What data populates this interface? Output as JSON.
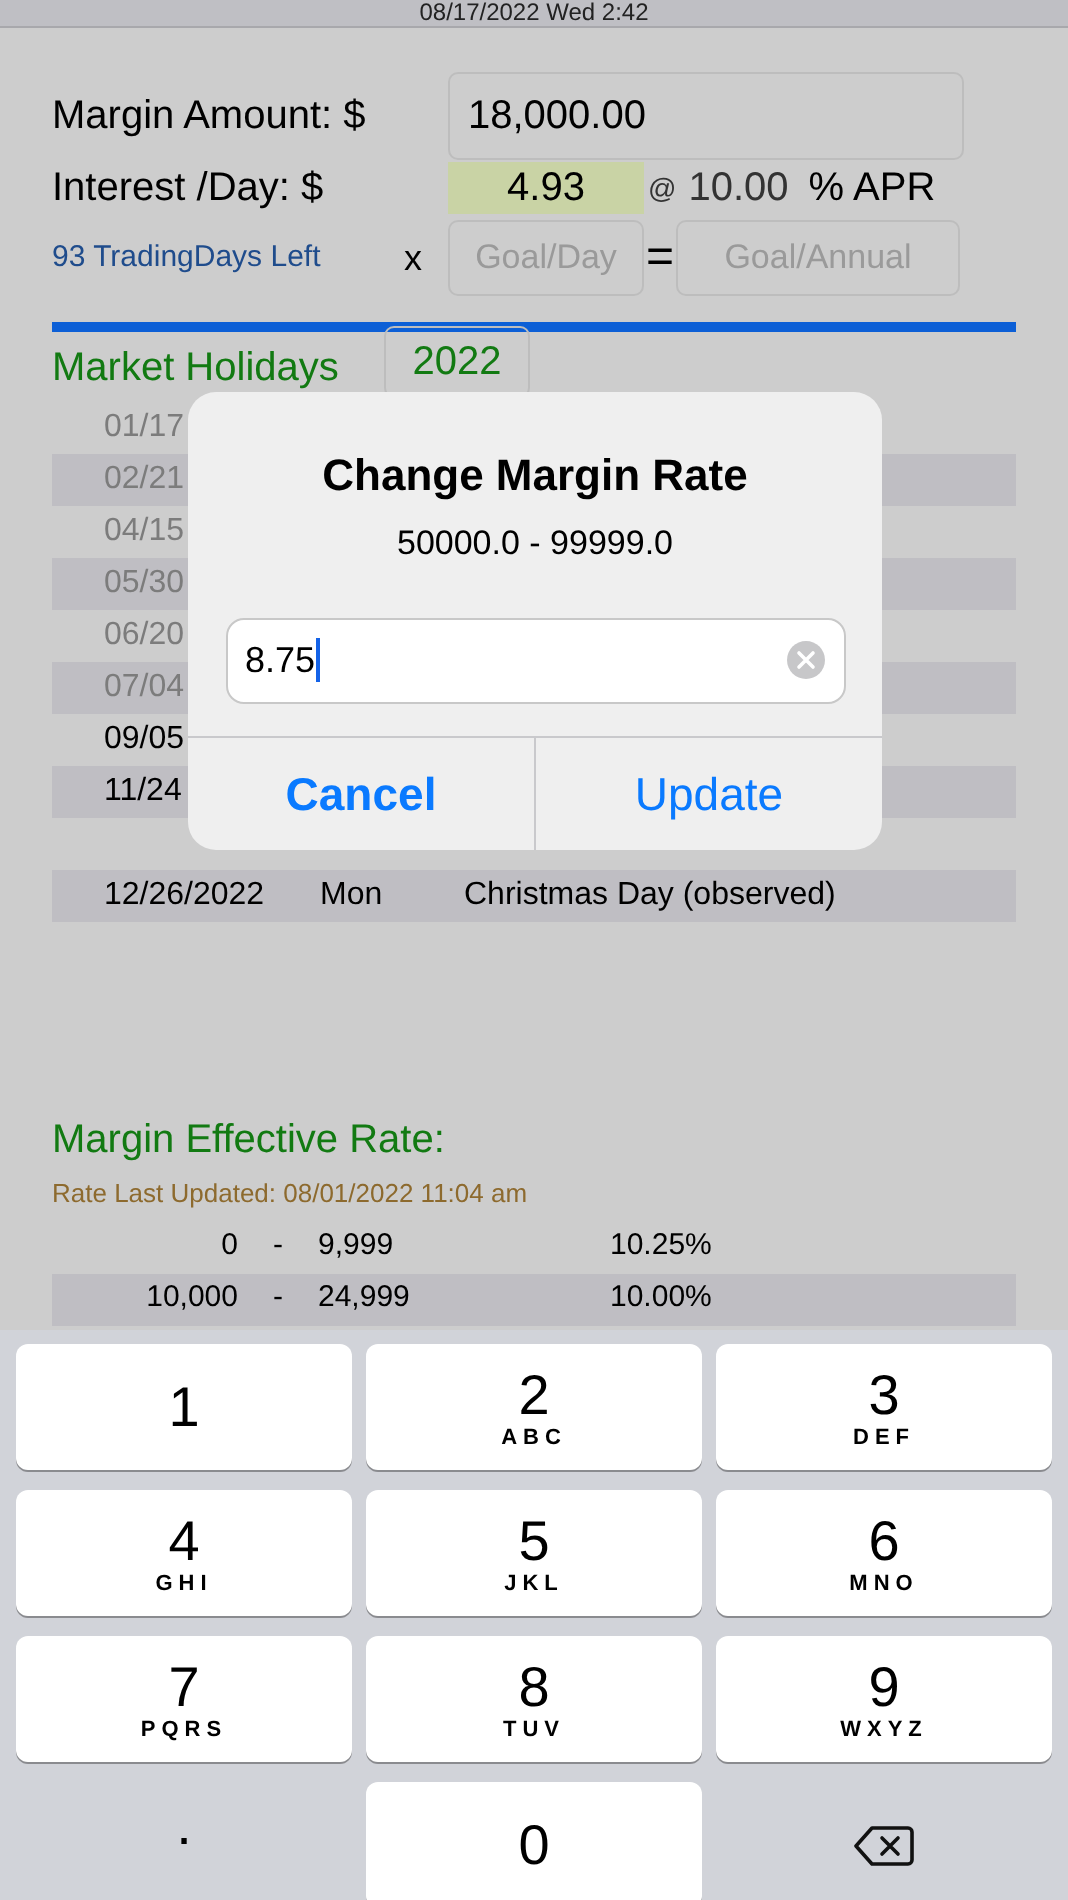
{
  "status_bar": {
    "time": "08/17/2022 Wed 2:42"
  },
  "margin": {
    "amount_label": "Margin Amount: $",
    "amount_value": "18,000.00",
    "interest_label": "Interest /Day: $",
    "interest_value": "4.93",
    "at": "@",
    "apr_value": "10.00",
    "apr_label": "% APR",
    "days_left": "93 TradingDays Left",
    "times": "x",
    "goal_day_placeholder": "Goal/Day",
    "equals": "=",
    "goal_annual_placeholder": "Goal/Annual"
  },
  "holidays": {
    "title": "Market Holidays",
    "year": "2022",
    "rows": [
      {
        "date": "01/17",
        "past": true
      },
      {
        "date": "02/21",
        "past": true
      },
      {
        "date": "04/15",
        "past": true
      },
      {
        "date": "05/30",
        "past": true
      },
      {
        "date": "06/20",
        "past": true
      },
      {
        "date": "07/04",
        "past": true
      },
      {
        "date": "09/05",
        "past": false
      },
      {
        "date": "11/24",
        "past": false
      },
      {
        "date": "12/26/2022",
        "day": "Mon",
        "name": "Christmas Day (observed)",
        "past": false
      }
    ]
  },
  "effective_rate": {
    "title": "Margin Effective Rate:",
    "updated": "Rate Last Updated: 08/01/2022 11:04 am",
    "rows": [
      {
        "from": "0",
        "dash": "-",
        "to": "9,999",
        "rate": "10.25%"
      },
      {
        "from": "10,000",
        "dash": "-",
        "to": "24,999",
        "rate": "10.00%"
      }
    ]
  },
  "dialog": {
    "title": "Change Margin Rate",
    "subtitle": "50000.0 - 99999.0",
    "value": "8.75",
    "buttons": [
      {
        "label": "Cancel",
        "bold": true
      },
      {
        "label": "Update",
        "bold": false
      }
    ]
  },
  "keyboard": {
    "keys": [
      {
        "kind": "digit",
        "digit": "1"
      },
      {
        "kind": "digit",
        "digit": "2",
        "letters": "ABC"
      },
      {
        "kind": "digit",
        "digit": "3",
        "letters": "DEF"
      },
      {
        "kind": "digit",
        "digit": "4",
        "letters": "GHI"
      },
      {
        "kind": "digit",
        "digit": "5",
        "letters": "JKL"
      },
      {
        "kind": "digit",
        "digit": "6",
        "letters": "MNO"
      },
      {
        "kind": "digit",
        "digit": "7",
        "letters": "PQRS"
      },
      {
        "kind": "digit",
        "digit": "8",
        "letters": "TUV"
      },
      {
        "kind": "digit",
        "digit": "9",
        "letters": "WXYZ"
      },
      {
        "kind": "plain",
        "digit": "."
      },
      {
        "kind": "digit",
        "digit": "0"
      },
      {
        "kind": "delete"
      }
    ]
  }
}
